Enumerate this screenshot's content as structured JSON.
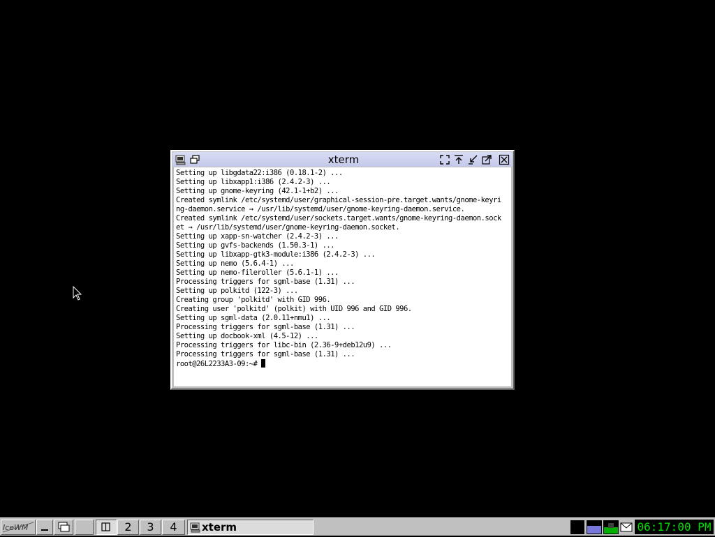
{
  "window": {
    "title": "xterm",
    "terminal_lines": [
      "Setting up libgdata22:i386 (0.18.1-2) ...",
      "Setting up libxapp1:i386 (2.4.2-3) ...",
      "Setting up gnome-keyring (42.1-1+b2) ...",
      "Created symlink /etc/systemd/user/graphical-session-pre.target.wants/gnome-keyri",
      "ng-daemon.service → /usr/lib/systemd/user/gnome-keyring-daemon.service.",
      "Created symlink /etc/systemd/user/sockets.target.wants/gnome-keyring-daemon.sock",
      "et → /usr/lib/systemd/user/gnome-keyring-daemon.socket.",
      "Setting up xapp-sn-watcher (2.4.2-3) ...",
      "Setting up gvfs-backends (1.50.3-1) ...",
      "Setting up libxapp-gtk3-module:i386 (2.4.2-3) ...",
      "Setting up nemo (5.6.4-1) ...",
      "Setting up nemo-fileroller (5.6.1-1) ...",
      "Processing triggers for sgml-base (1.31) ...",
      "Setting up polkitd (122-3) ...",
      "Creating group 'polkitd' with GID 996.",
      "Creating user 'polkitd' (polkit) with UID 996 and GID 996.",
      "Setting up sgml-data (2.0.11+nmu1) ...",
      "Processing triggers for sgml-base (1.31) ...",
      "Setting up docbook-xml (4.5-12) ...",
      "Processing triggers for libc-bin (2.36-9+deb12u9) ...",
      "Processing triggers for sgml-base (1.31) ..."
    ],
    "prompt": "root@26L2233A3-09:~# "
  },
  "taskbar": {
    "start_label": "IceWM",
    "workspaces": [
      "2",
      "3",
      "4"
    ],
    "task_label": "xterm",
    "clock": "06:17:00 PM"
  },
  "colors": {
    "desktop": "#000000",
    "titlebar": "#c8ccec",
    "clock_text": "#00e000"
  }
}
